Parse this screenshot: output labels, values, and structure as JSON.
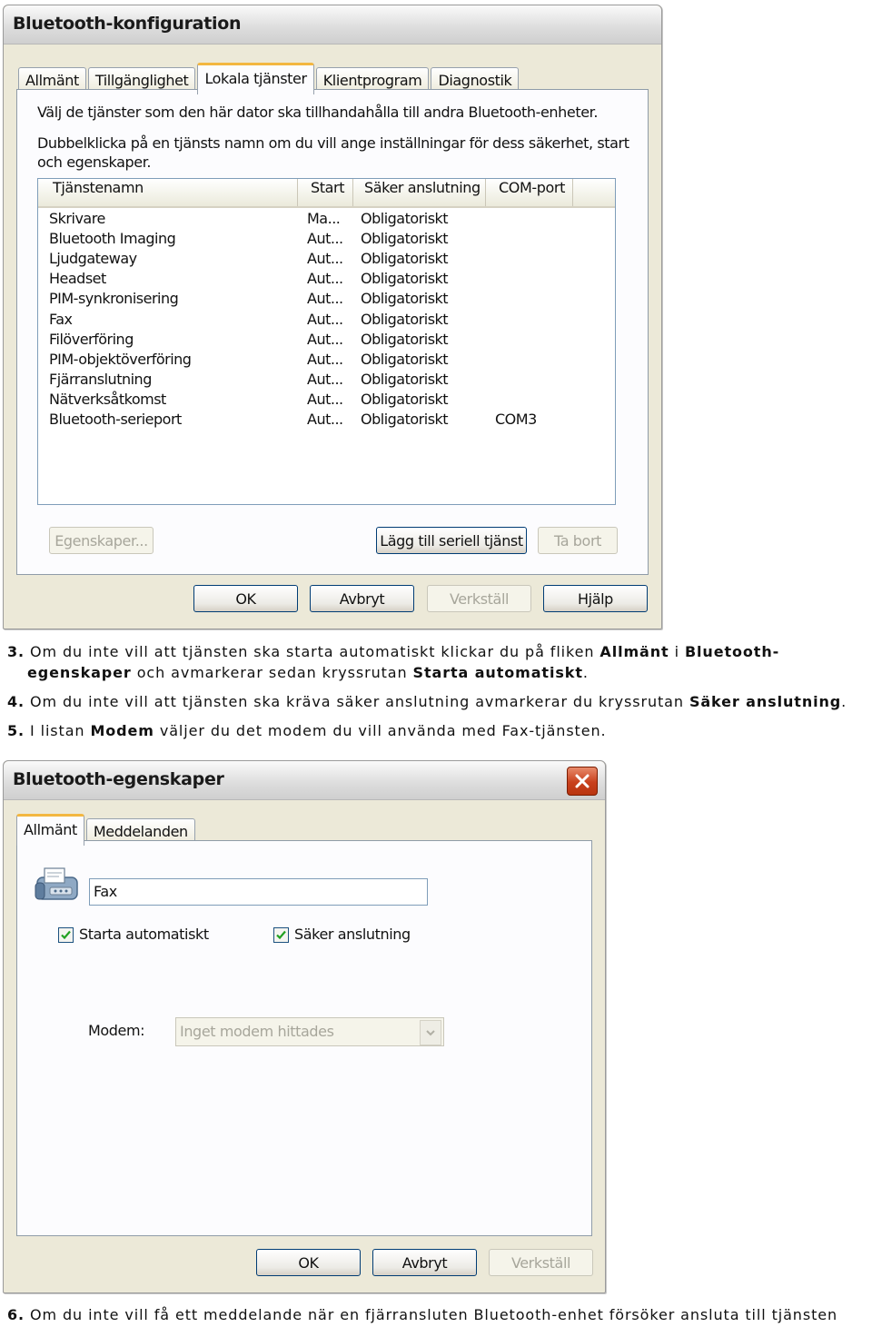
{
  "window1": {
    "title": "Bluetooth-konfiguration",
    "tabs": [
      {
        "label": "Allmänt"
      },
      {
        "label": "Tillgänglighet"
      },
      {
        "label": "Lokala tjänster"
      },
      {
        "label": "Klientprogram"
      },
      {
        "label": "Diagnostik"
      }
    ],
    "active_tab": "Lokala tjänster",
    "intro_line1": "Välj de tjänster som den här dator ska tillhandahålla till andra Bluetooth-enheter.",
    "intro_line2": "Dubbelklicka på en tjänsts namn om du vill ange inställningar för dess säkerhet, start",
    "intro_line3": "och egenskaper.",
    "columns": {
      "name": "Tjänstenamn",
      "start": "Start",
      "secure": "Säker anslutning",
      "com": "COM-port"
    },
    "services": [
      {
        "name": "Skrivare",
        "start": "Ma...",
        "secure": "Obligatoriskt",
        "com": ""
      },
      {
        "name": "Bluetooth Imaging",
        "start": "Aut...",
        "secure": "Obligatoriskt",
        "com": ""
      },
      {
        "name": "Ljudgateway",
        "start": "Aut...",
        "secure": "Obligatoriskt",
        "com": ""
      },
      {
        "name": "Headset",
        "start": "Aut...",
        "secure": "Obligatoriskt",
        "com": ""
      },
      {
        "name": "PIM-synkronisering",
        "start": "Aut...",
        "secure": "Obligatoriskt",
        "com": ""
      },
      {
        "name": "Fax",
        "start": "Aut...",
        "secure": "Obligatoriskt",
        "com": ""
      },
      {
        "name": "Filöverföring",
        "start": "Aut...",
        "secure": "Obligatoriskt",
        "com": ""
      },
      {
        "name": "PIM-objektöverföring",
        "start": "Aut...",
        "secure": "Obligatoriskt",
        "com": ""
      },
      {
        "name": "Fjärranslutning",
        "start": "Aut...",
        "secure": "Obligatoriskt",
        "com": ""
      },
      {
        "name": "Nätverksåtkomst",
        "start": "Aut...",
        "secure": "Obligatoriskt",
        "com": ""
      },
      {
        "name": "Bluetooth-serieport",
        "start": "Aut...",
        "secure": "Obligatoriskt",
        "com": "COM3"
      }
    ],
    "buttons": {
      "properties": "Egenskaper...",
      "add_serial": "Lägg till seriell tjänst",
      "remove": "Ta bort",
      "ok": "OK",
      "cancel": "Avbryt",
      "apply": "Verkställ",
      "help": "Hjälp"
    }
  },
  "doc": {
    "step3_num": "3.",
    "step3_a": "Om du inte vill att tjänsten ska starta automatiskt klickar du på fliken",
    "step3_b1": "Allmänt",
    "step3_c": "i",
    "step3_b2": "Bluetooth-",
    "step3_line2_b": "egenskaper",
    "step3_line2_a": "och avmarkerar sedan kryssrutan",
    "step3_line2_b2": "Starta automatiskt",
    "step3_line2_end": ".",
    "step4_num": "4.",
    "step4_a": "Om du inte vill att tjänsten ska kräva säker anslutning avmarkerar du kryssrutan",
    "step4_b": "Säker anslutning",
    "step4_end": ".",
    "step5_num": "5.",
    "step5_a": "I listan",
    "step5_b": "Modem",
    "step5_c": "väljer du det modem du vill använda med Fax-tjänsten.",
    "step6_num": "6.",
    "step6_a": "Om du inte vill få ett meddelande när en fjärransluten Bluetooth-enhet försöker ansluta till tjänsten"
  },
  "window2": {
    "title": "Bluetooth-egenskaper",
    "tabs": [
      {
        "label": "Allmänt"
      },
      {
        "label": "Meddelanden"
      }
    ],
    "active_tab": "Allmänt",
    "service_name_value": "Fax",
    "auto_start_label": "Starta automatiskt",
    "auto_start_checked": true,
    "secure_label": "Säker anslutning",
    "secure_checked": true,
    "modem_label": "Modem:",
    "modem_value": "Inget modem hittades",
    "buttons": {
      "ok": "OK",
      "cancel": "Avbryt",
      "apply": "Verkställ"
    }
  }
}
